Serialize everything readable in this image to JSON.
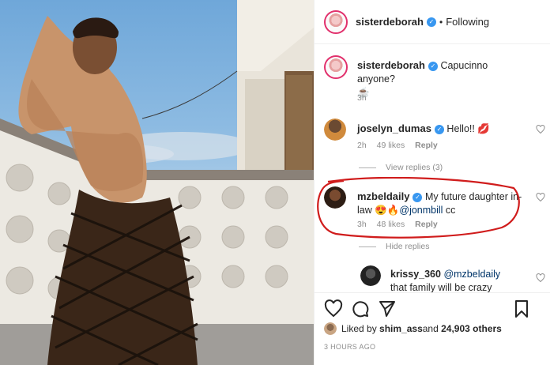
{
  "post": {
    "author": "sisterdeborah",
    "follow_status": "Following",
    "separator": "•",
    "caption_author": "sisterdeborah",
    "caption_text": "Capucinno anyone?",
    "caption_emoji": "☕",
    "caption_time": "3h"
  },
  "comments": [
    {
      "username": "joselyn_dumas",
      "text": "Hello!! ",
      "emoji": "💋",
      "time": "2h",
      "likes": "49 likes",
      "reply": "Reply",
      "view_replies": "View replies (3)"
    },
    {
      "username": "mzbeldaily",
      "text": "My future daughter in-law ",
      "emoji": "😍🔥",
      "mention": "@jonmbill",
      "suffix": " cc",
      "time": "3h",
      "likes": "48 likes",
      "reply": "Reply",
      "hide_replies": "Hide replies"
    },
    {
      "username": "krissy_360",
      "mention": "@mzbeldaily",
      "text": "that family will be crazy"
    }
  ],
  "footer": {
    "liked_by_prefix": "Liked by ",
    "liked_by_user": "shim_ass",
    "liked_by_and": " and ",
    "liked_by_count": "24,903 others",
    "timestamp": "3 HOURS AGO"
  },
  "icons": {
    "verified": "verified-badge-icon",
    "heart": "heart-icon",
    "comment": "comment-icon",
    "share": "share-icon",
    "bookmark": "bookmark-icon"
  },
  "colors": {
    "verified": "#3897f0",
    "story_ring": "#e1306c",
    "annotation": "#d01c1c",
    "muted_text": "#8e8e8e"
  }
}
